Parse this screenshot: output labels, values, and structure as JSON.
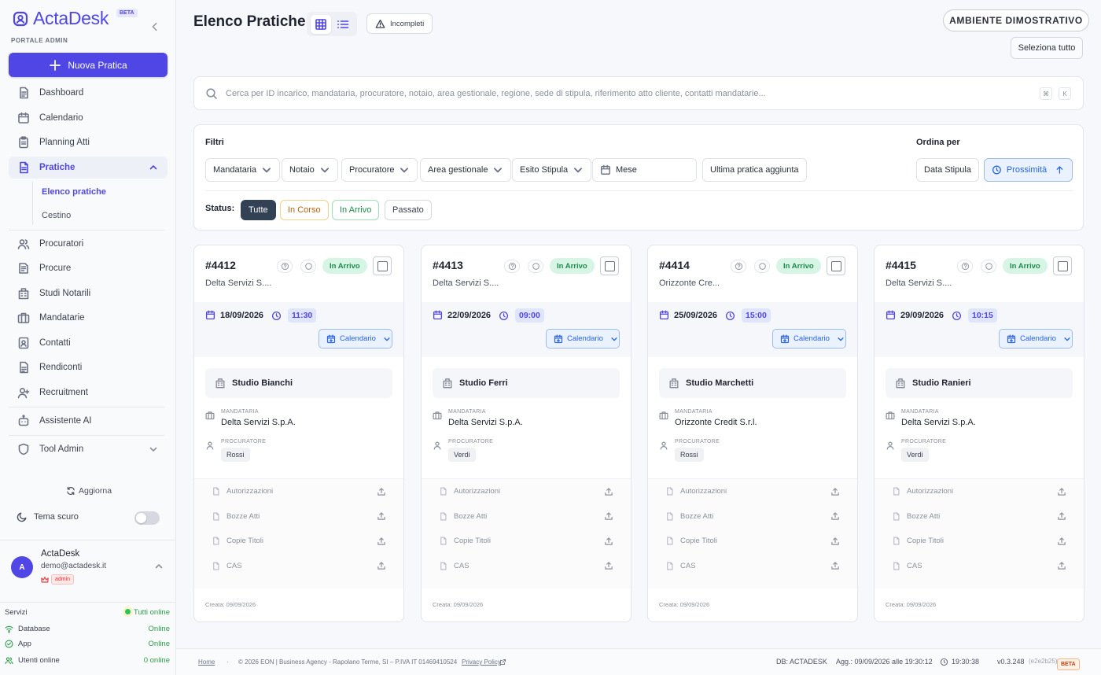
{
  "app": {
    "name": "ActaDesk",
    "beta": "BETA",
    "portal": "PORTALE ADMIN"
  },
  "sidebar": {
    "new_button": "Nuova Pratica",
    "items": [
      {
        "label": "Dashboard",
        "icon": "document-icon"
      },
      {
        "label": "Calendario",
        "icon": "calendar-icon"
      },
      {
        "label": "Planning Atti",
        "icon": "clipboard-icon"
      },
      {
        "label": "Pratiche",
        "icon": "file-icon"
      },
      {
        "label": "Procuratori",
        "icon": "users-icon"
      },
      {
        "label": "Procure",
        "icon": "stamp-icon"
      },
      {
        "label": "Studi Notarili",
        "icon": "building-icon"
      },
      {
        "label": "Mandatarie",
        "icon": "briefcase-icon"
      },
      {
        "label": "Contatti",
        "icon": "contact-icon"
      },
      {
        "label": "Rendiconti",
        "icon": "report-icon"
      },
      {
        "label": "Recruitment",
        "icon": "user-plus-icon"
      },
      {
        "label": "Assistente AI",
        "icon": "bot-icon"
      },
      {
        "label": "Tool Admin",
        "icon": "shield-icon"
      }
    ],
    "subitems": [
      "Elenco pratiche",
      "Cestino"
    ],
    "refresh": "Aggiorna",
    "theme": "Tema scuro",
    "user": {
      "initial": "A",
      "name": "ActaDesk",
      "email": "demo@actadesk.it",
      "role": "admin"
    },
    "services": {
      "label": "Servizi",
      "status": "Tutti online",
      "rows": [
        {
          "label": "Database",
          "value": "Online"
        },
        {
          "label": "App",
          "value": "Online"
        },
        {
          "label": "Utenti online",
          "value": "0 online"
        }
      ]
    }
  },
  "header": {
    "title": "Elenco Pratiche",
    "incomplete": "Incompleti",
    "environment": "AMBIENTE DIMOSTRATIVO",
    "select_all": "Seleziona tutto"
  },
  "search": {
    "placeholder": "Cerca per ID incarico, mandataria, procuratore, notaio, area gestionale, regione, sede di stipula, riferimento atto cliente, contatti mandatarie...",
    "key1": "⌘",
    "key2": "K"
  },
  "filters": {
    "title": "Filtri",
    "buttons": [
      "Mandataria",
      "Notaio",
      "Procuratore",
      "Area gestionale",
      "Esito Stipula"
    ],
    "month": "Mese",
    "last_added": "Ultima pratica aggiunta",
    "order_title": "Ordina per",
    "order_date": "Data Stipula",
    "order_proximity": "Prossimità",
    "status_label": "Status:",
    "statuses": [
      "Tutte",
      "In Corso",
      "In Arrivo",
      "Passato"
    ]
  },
  "cards": [
    {
      "id": "#4412",
      "subtitle": "Delta Servizi S....",
      "status": "In Arrivo",
      "date": "18/09/2026",
      "time": "11:30",
      "calendar": "Calendario",
      "studio": "Studio Bianchi",
      "mandataria_label": "MANDATARIA",
      "mandataria": "Delta Servizi S.p.A.",
      "procuratore_label": "PROCURATORE",
      "procuratore": "Rossi",
      "docs": [
        "Autorizzazioni",
        "Bozze Atti",
        "Copie Titoli",
        "CAS"
      ],
      "created": "Creata: 09/09/2026"
    },
    {
      "id": "#4413",
      "subtitle": "Delta Servizi S....",
      "status": "In Arrivo",
      "date": "22/09/2026",
      "time": "09:00",
      "calendar": "Calendario",
      "studio": "Studio Ferri",
      "mandataria_label": "MANDATARIA",
      "mandataria": "Delta Servizi S.p.A.",
      "procuratore_label": "PROCURATORE",
      "procuratore": "Verdi",
      "docs": [
        "Autorizzazioni",
        "Bozze Atti",
        "Copie Titoli",
        "CAS"
      ],
      "created": "Creata: 09/09/2026"
    },
    {
      "id": "#4414",
      "subtitle": "Orizzonte Cre...",
      "status": "In Arrivo",
      "date": "25/09/2026",
      "time": "15:00",
      "calendar": "Calendario",
      "studio": "Studio Marchetti",
      "mandataria_label": "MANDATARIA",
      "mandataria": "Orizzonte Credit S.r.l.",
      "procuratore_label": "PROCURATORE",
      "procuratore": "Rossi",
      "docs": [
        "Autorizzazioni",
        "Bozze Atti",
        "Copie Titoli",
        "CAS"
      ],
      "created": "Creata: 09/09/2026"
    },
    {
      "id": "#4415",
      "subtitle": "Delta Servizi S....",
      "status": "In Arrivo",
      "date": "29/09/2026",
      "time": "10:15",
      "calendar": "Calendario",
      "studio": "Studio Ranieri",
      "mandataria_label": "MANDATARIA",
      "mandataria": "Delta Servizi S.p.A.",
      "procuratore_label": "PROCURATORE",
      "procuratore": "Verdi",
      "docs": [
        "Autorizzazioni",
        "Bozze Atti",
        "Copie Titoli",
        "CAS"
      ],
      "created": "Creata: 09/09/2026"
    }
  ],
  "footer": {
    "home": "Home",
    "copyright": "© 2026 EON | Business Agency - Rapolano Terme, SI – P.IVA IT 01469410524",
    "privacy": "Privacy Policy",
    "db": "DB: ACTADESK",
    "updated": "Agg.: 09/09/2026 alle 19:30:12",
    "clock": "19:30:38",
    "version": "v0.3.248",
    "build": "(e2e2b25)",
    "beta": "BETA"
  },
  "colors": {
    "accent": "#4f46e5",
    "status_green": "#1f8a4c",
    "link_blue": "#2563eb"
  }
}
